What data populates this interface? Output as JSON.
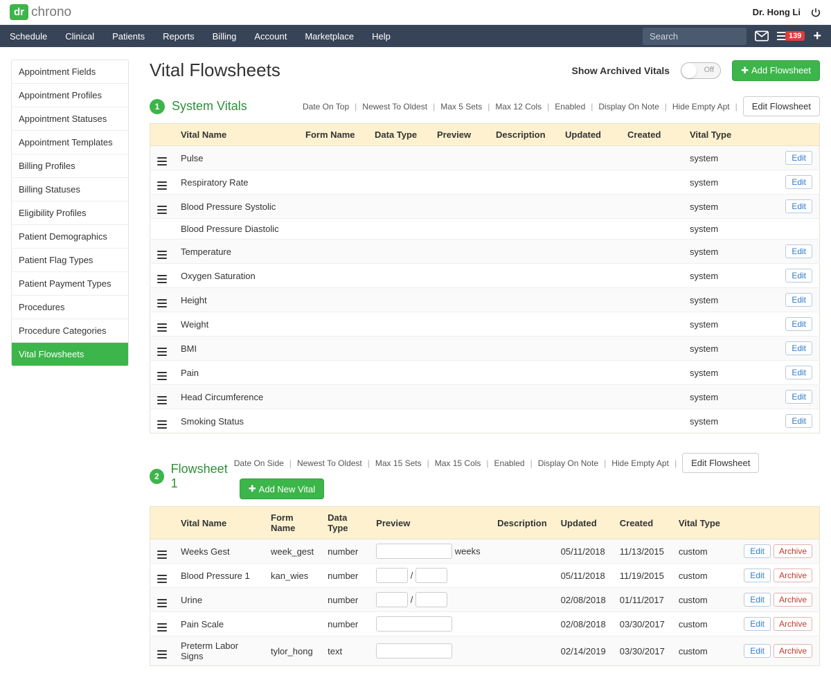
{
  "brand": {
    "logo": "dr",
    "text": "chrono"
  },
  "user": {
    "name": "Dr. Hong Li"
  },
  "nav": {
    "items": [
      "Schedule",
      "Clinical",
      "Patients",
      "Reports",
      "Billing",
      "Account",
      "Marketplace",
      "Help"
    ],
    "search_placeholder": "Search",
    "badge_count": "139"
  },
  "sidebar": {
    "items": [
      "Appointment Fields",
      "Appointment Profiles",
      "Appointment Statuses",
      "Appointment Templates",
      "Billing Profiles",
      "Billing Statuses",
      "Eligibility Profiles",
      "Patient Demographics",
      "Patient Flag Types",
      "Patient Payment Types",
      "Procedures",
      "Procedure Categories",
      "Vital Flowsheets"
    ],
    "active_index": 12
  },
  "page": {
    "title": "Vital Flowsheets",
    "archived_label": "Show Archived Vitals",
    "toggle_label": "Off",
    "add_flowsheet": "Add Flowsheet"
  },
  "section1": {
    "num": "1",
    "title": "System Vitals",
    "opts": [
      "Date On Top",
      "Newest To Oldest",
      "Max 5 Sets",
      "Max 12 Cols",
      "Enabled",
      "Display On Note",
      "Hide Empty Apt"
    ],
    "edit_label": "Edit Flowsheet",
    "headers": [
      "Vital Name",
      "Form Name",
      "Data Type",
      "Preview",
      "Description",
      "Updated",
      "Created",
      "Vital Type",
      ""
    ],
    "rows": [
      {
        "drag": true,
        "name": "Pulse",
        "type": "system"
      },
      {
        "drag": true,
        "name": "Respiratory Rate",
        "type": "system"
      },
      {
        "drag": true,
        "name": "Blood Pressure Systolic",
        "type": "system"
      },
      {
        "drag": false,
        "name": "Blood Pressure Diastolic",
        "type": "system",
        "noedit": true
      },
      {
        "drag": true,
        "name": "Temperature",
        "type": "system"
      },
      {
        "drag": true,
        "name": "Oxygen Saturation",
        "type": "system"
      },
      {
        "drag": true,
        "name": "Height",
        "type": "system"
      },
      {
        "drag": true,
        "name": "Weight",
        "type": "system"
      },
      {
        "drag": true,
        "name": "BMI",
        "type": "system"
      },
      {
        "drag": true,
        "name": "Pain",
        "type": "system"
      },
      {
        "drag": true,
        "name": "Head Circumference",
        "type": "system"
      },
      {
        "drag": true,
        "name": "Smoking Status",
        "type": "system"
      }
    ],
    "edit_btn": "Edit"
  },
  "section2": {
    "num": "2",
    "title": "Flowsheet 1",
    "opts": [
      "Date On Side",
      "Newest To Oldest",
      "Max 15 Sets",
      "Max 15 Cols",
      "Enabled",
      "Display On Note",
      "Hide Empty Apt"
    ],
    "edit_label": "Edit Flowsheet",
    "add_vital": "Add New Vital",
    "headers": [
      "Vital Name",
      "Form Name",
      "Data Type",
      "Preview",
      "Description",
      "Updated",
      "Created",
      "Vital Type",
      ""
    ],
    "rows": [
      {
        "name": "Weeks Gest",
        "form": "week_gest",
        "dtype": "number",
        "preview": "single",
        "suffix": "weeks",
        "updated": "05/11/2018",
        "created": "11/13/2015",
        "vtype": "custom"
      },
      {
        "name": "Blood Pressure 1",
        "form": "kan_wies",
        "dtype": "number",
        "preview": "pair",
        "updated": "05/11/2018",
        "created": "11/19/2015",
        "vtype": "custom"
      },
      {
        "name": "Urine",
        "form": "",
        "dtype": "number",
        "preview": "pair",
        "updated": "02/08/2018",
        "created": "01/11/2017",
        "vtype": "custom"
      },
      {
        "name": "Pain Scale",
        "form": "",
        "dtype": "number",
        "preview": "single",
        "updated": "02/08/2018",
        "created": "03/30/2017",
        "vtype": "custom"
      },
      {
        "name": "Preterm Labor Signs",
        "form": "tylor_hong",
        "dtype": "text",
        "preview": "single",
        "updated": "02/14/2019",
        "created": "03/30/2017",
        "vtype": "custom"
      }
    ],
    "edit_btn": "Edit",
    "archive_btn": "Archive"
  }
}
